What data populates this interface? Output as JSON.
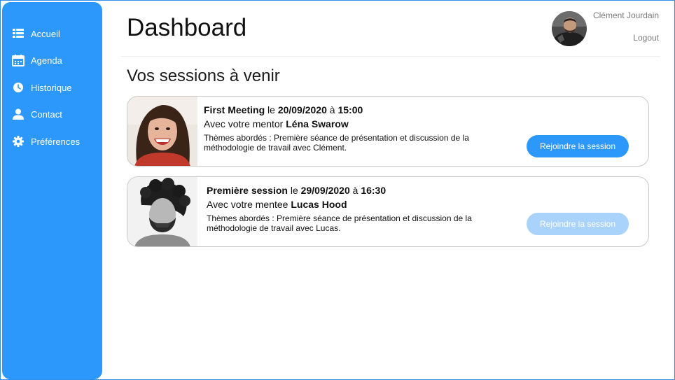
{
  "sidebar": {
    "accent_color": "#2d98fb",
    "items": [
      {
        "label": "Accueil",
        "icon": "list-icon"
      },
      {
        "label": "Agenda",
        "icon": "calendar-icon"
      },
      {
        "label": "Historique",
        "icon": "clock-icon"
      },
      {
        "label": "Contact",
        "icon": "person-icon"
      },
      {
        "label": "Préférences",
        "icon": "gear-icon"
      }
    ]
  },
  "header": {
    "title": "Dashboard",
    "user_name": "Clément Jourdain",
    "logout_label": "Logout"
  },
  "main": {
    "section_title": "Vos sessions à venir",
    "sessions": [
      {
        "name": "First Meeting",
        "date_prefix": "le",
        "date": "20/09/2020",
        "time_prefix": "à",
        "time": "15:00",
        "role_prefix": "Avec votre mentor",
        "person": "Léna Swarow",
        "topics": "Thèmes abordés : Première séance de présentation et discussion de la méthodologie de travail avec Clément.",
        "button_label": "Rejoindre la session",
        "button_state": "active"
      },
      {
        "name": "Première session",
        "date_prefix": "le",
        "date": "29/09/2020",
        "time_prefix": "à",
        "time": "16:30",
        "role_prefix": "Avec votre mentee",
        "person": "Lucas Hood",
        "topics": "Thèmes abordés : Première séance de présentation et discussion de la méthodologie de travail avec Lucas.",
        "button_label": "Rejoindre la session",
        "button_state": "disabled"
      }
    ]
  }
}
